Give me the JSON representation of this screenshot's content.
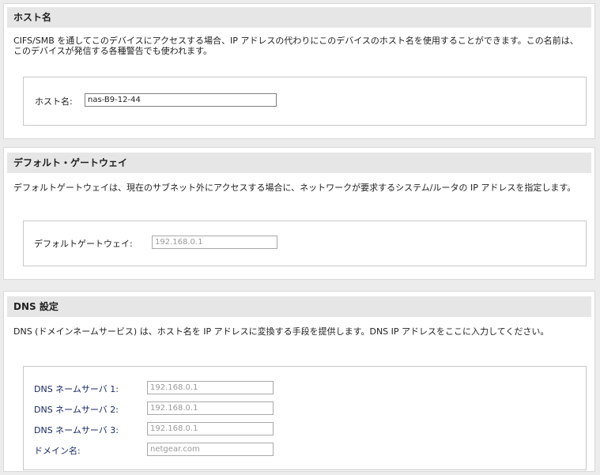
{
  "hostname": {
    "title": "ホスト名",
    "description": "CIFS/SMB を通してこのデバイスにアクセスする場合、IP アドレスの代わりにこのデバイスのホスト名を使用することができます。この名前は、このデバイスが発信する各種警告でも使われます。",
    "label": "ホスト名:",
    "value": "nas-B9-12-44"
  },
  "gateway": {
    "title": "デフォルト・ゲートウェイ",
    "description": "デフォルトゲートウェイは、現在のサブネット外にアクセスする場合に、ネットワークが要求するシステム/ルータの IP アドレスを指定します。",
    "label": "デフォルトゲートウェイ:",
    "value": "192.168.0.1"
  },
  "dns": {
    "title": "DNS 設定",
    "description": "DNS (ドメインネームサービス) は、ホスト名を IP アドレスに変換する手段を提供します。DNS IP アドレスをここに入力してください。",
    "server1_label": "DNS ネームサーバ 1:",
    "server1_value": "192.168.0.1",
    "server2_label": "DNS ネームサーバ 2:",
    "server2_value": "192.168.0.1",
    "server3_label": "DNS ネームサーバ 3:",
    "server3_value": "192.168.0.1",
    "domain_label": "ドメイン名:",
    "domain_value": "netgear.com"
  }
}
